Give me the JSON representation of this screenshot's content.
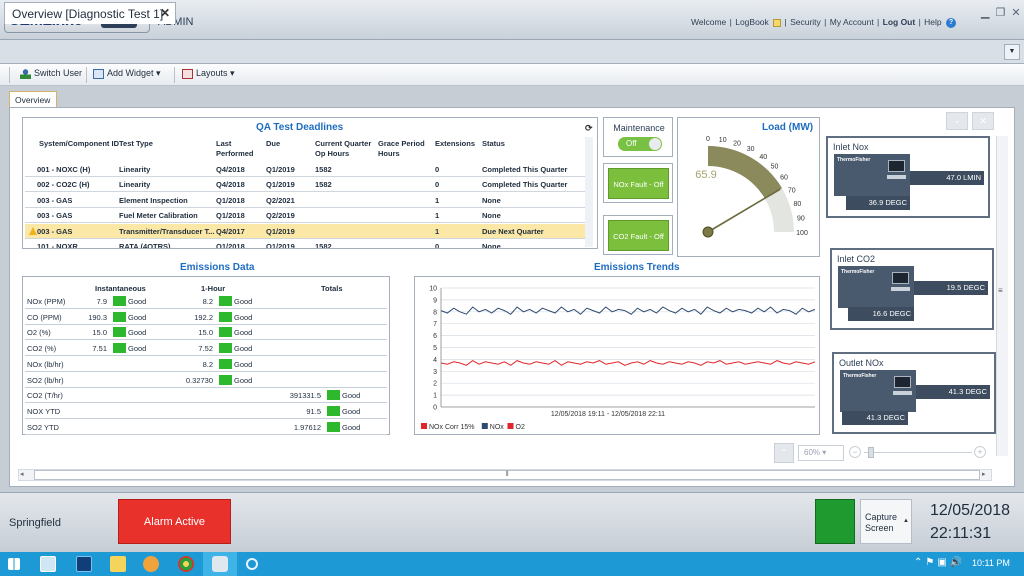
{
  "header": {
    "logo_text": "CEMLink6",
    "menu_label": "Menu",
    "user_label": "ADMIN",
    "links": [
      "Welcome",
      "LogBook",
      "Security",
      "My Account",
      "Log Out",
      "Help"
    ]
  },
  "tabs": {
    "document_tab": "Overview [Diagnostic Test 1]"
  },
  "toolbar": {
    "switch_user": "Switch User",
    "add_widget": "Add Widget",
    "layouts": "Layouts"
  },
  "overview_tab": "Overview",
  "qa": {
    "title": "QA Test Deadlines",
    "headers": [
      "System/Component ID",
      "Test Type",
      "Last Performed",
      "Due",
      "Current Quarter Op Hours",
      "Grace Period Hours",
      "Extensions",
      "Status"
    ],
    "rows": [
      {
        "id": "001 - NOXC (H)",
        "test": "Linearity",
        "last": "Q4/2018",
        "due": "Q1/2019",
        "op": "1582",
        "grace": "",
        "ext": "0",
        "status": "Completed This Quarter",
        "warn": false
      },
      {
        "id": "002 - CO2C (H)",
        "test": "Linearity",
        "last": "Q4/2018",
        "due": "Q1/2019",
        "op": "1582",
        "grace": "",
        "ext": "0",
        "status": "Completed This Quarter",
        "warn": false
      },
      {
        "id": "003 - GAS",
        "test": "Element Inspection",
        "last": "Q1/2018",
        "due": "Q2/2021",
        "op": "",
        "grace": "",
        "ext": "1",
        "status": "None",
        "warn": false
      },
      {
        "id": "003 - GAS",
        "test": "Fuel Meter Calibration",
        "last": "Q1/2018",
        "due": "Q2/2019",
        "op": "",
        "grace": "",
        "ext": "1",
        "status": "None",
        "warn": false
      },
      {
        "id": "003 - GAS",
        "test": "Transmitter/Transducer T...",
        "last": "Q4/2017",
        "due": "Q1/2019",
        "op": "",
        "grace": "",
        "ext": "1",
        "status": "Due Next Quarter",
        "warn": true
      },
      {
        "id": "101 - NOXR",
        "test": "RATA (4QTRS)",
        "last": "Q1/2018",
        "due": "Q1/2019",
        "op": "1582",
        "grace": "",
        "ext": "0",
        "status": "None",
        "warn": false
      }
    ]
  },
  "emissions": {
    "title": "Emissions Data",
    "col_instant": "Instantaneous",
    "col_hour": "1-Hour",
    "col_totals": "Totals",
    "good": "Good",
    "rows": [
      {
        "label": "NOx (PPM)",
        "inst": "7.9",
        "inst_good": true,
        "hour": "8.2",
        "hour_good": true,
        "total": "",
        "total_good": false
      },
      {
        "label": "CO (PPM)",
        "inst": "190.3",
        "inst_good": true,
        "hour": "192.2",
        "hour_good": true,
        "total": "",
        "total_good": false
      },
      {
        "label": "O2 (%)",
        "inst": "15.0",
        "inst_good": true,
        "hour": "15.0",
        "hour_good": true,
        "total": "",
        "total_good": false
      },
      {
        "label": "CO2 (%)",
        "inst": "7.51",
        "inst_good": true,
        "hour": "7.52",
        "hour_good": true,
        "total": "",
        "total_good": false
      },
      {
        "label": "NOx (lb/hr)",
        "inst": "",
        "inst_good": false,
        "hour": "8.2",
        "hour_good": true,
        "total": "",
        "total_good": false
      },
      {
        "label": "SO2 (lb/hr)",
        "inst": "",
        "inst_good": false,
        "hour": "0.32730",
        "hour_good": true,
        "total": "",
        "total_good": false
      },
      {
        "label": "CO2 (T/hr)",
        "inst": "",
        "inst_good": false,
        "hour": "",
        "hour_good": false,
        "total": "391331.5",
        "total_good": true
      },
      {
        "label": "NOX YTD",
        "inst": "",
        "inst_good": false,
        "hour": "",
        "hour_good": false,
        "total": "91.5",
        "total_good": true
      },
      {
        "label": "SO2 YTD",
        "inst": "",
        "inst_good": false,
        "hour": "",
        "hour_good": false,
        "total": "1.97612",
        "total_good": true
      }
    ]
  },
  "chart_data": {
    "type": "line",
    "title": "Emissions Trends",
    "xlabel": "12/05/2018 19:11 - 12/05/2018 22:11",
    "ylabel": "",
    "ylim": [
      0,
      10
    ],
    "yticks": [
      "0",
      "1",
      "2",
      "3",
      "4",
      "5",
      "6",
      "7",
      "8",
      "9",
      "10"
    ],
    "grid": true,
    "legend_position": "bottom-left",
    "series": [
      {
        "name": "NOx Corr 15%",
        "color": "#e0262b",
        "values": [
          3.7,
          3.6,
          3.8,
          3.7,
          3.5,
          3.9,
          3.6,
          3.8,
          3.7,
          3.6,
          3.8,
          3.5,
          3.9,
          3.7,
          3.6,
          3.8,
          3.7,
          3.6,
          3.9,
          3.5,
          3.8,
          3.7,
          3.6,
          3.8,
          3.7,
          3.9,
          3.6,
          3.7,
          3.8,
          3.5,
          3.7,
          3.8,
          3.6,
          3.9,
          3.7,
          3.6,
          3.8,
          3.7,
          3.6,
          3.8,
          3.7,
          3.5,
          3.8,
          3.7,
          3.9,
          3.6,
          3.7,
          3.8,
          3.6,
          3.7,
          3.8,
          3.7,
          3.6,
          3.9,
          3.7,
          3.6,
          3.8,
          3.7,
          3.6,
          3.8
        ]
      },
      {
        "name": "NOx",
        "color": "#2f4a70",
        "values": [
          8.1,
          7.9,
          8.3,
          8.0,
          7.8,
          8.4,
          8.0,
          8.2,
          7.9,
          8.3,
          8.1,
          7.8,
          8.4,
          8.0,
          8.2,
          7.9,
          8.3,
          8.1,
          7.9,
          8.4,
          8.0,
          8.2,
          7.8,
          8.3,
          8.1,
          7.9,
          8.4,
          8.0,
          8.2,
          8.1,
          7.8,
          8.3,
          8.0,
          8.2,
          7.9,
          8.4,
          8.1,
          7.9,
          8.3,
          8.0,
          8.2,
          7.8,
          8.4,
          8.1,
          7.9,
          8.3,
          8.0,
          8.2,
          8.1,
          7.9,
          8.3,
          8.0,
          8.4,
          7.9,
          8.2,
          8.1,
          7.8,
          8.3,
          8.0,
          8.2
        ]
      },
      {
        "name": "O2",
        "color": "#e0262b",
        "values": []
      }
    ]
  },
  "status_toggles": {
    "maintenance_label": "Maintenance",
    "maintenance_state": "Off",
    "nox_fault": "NOx Fault - Off",
    "co2_fault": "CO2 Fault - Off"
  },
  "gauge": {
    "title": "Load (MW)",
    "value": 65.9,
    "value_text": "65.9",
    "min": 0,
    "max": 100,
    "ticks": [
      "0",
      "10",
      "20",
      "30",
      "40",
      "50",
      "60",
      "70",
      "80",
      "90",
      "100"
    ]
  },
  "analyzers": [
    {
      "label": "Inlet Nox",
      "brand": "ThermoFisher",
      "reading_main": "47.0 LMIN",
      "reading_temp": "36.9 DEGC"
    },
    {
      "label": "Inlet CO2",
      "brand": "ThermoFisher",
      "reading_main": "19.5 DEGC",
      "reading_temp": "16.6 DEGC"
    },
    {
      "label": "Outlet NOx",
      "brand": "ThermoFisher",
      "reading_main": "41.3 DEGC",
      "reading_temp": "41.3 DEGC"
    }
  ],
  "zoom": {
    "value": "60%"
  },
  "statusbar": {
    "site": "Springfield",
    "alarm": "Alarm Active",
    "capture_line1": "Capture",
    "capture_line2": "Screen",
    "date": "12/05/2018",
    "time": "22:11:31"
  },
  "taskbar": {
    "clock": "10:11 PM"
  }
}
